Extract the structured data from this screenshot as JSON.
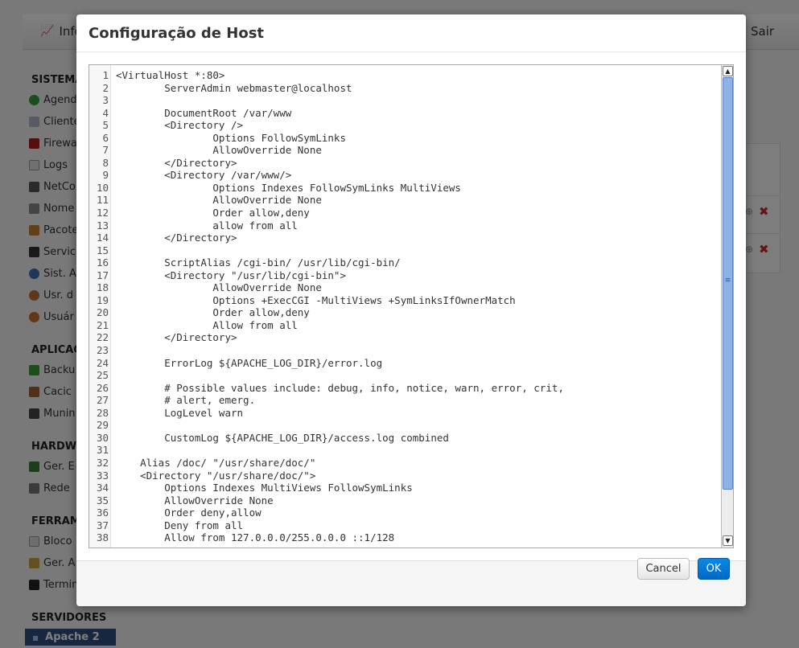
{
  "background": {
    "top_left_label": "Info",
    "top_right_label": "Sair",
    "sections": [
      {
        "title": "SISTEMA",
        "items": [
          "Agend",
          "Cliente",
          "Firewa",
          "Logs",
          "NetCo",
          "Nome",
          "Pacote",
          "Servic",
          "Sist. A",
          "Usr. d",
          "Usuár"
        ]
      },
      {
        "title": "APLICAÇ",
        "items": [
          "Backu",
          "Cacic",
          "Munin"
        ]
      },
      {
        "title": "HARDW",
        "items": [
          "Ger. E",
          "Rede"
        ]
      },
      {
        "title": "FERRAM",
        "items": [
          "Bloco",
          "Ger. A",
          "Termin"
        ]
      },
      {
        "title": "SERVIDORES",
        "items": []
      }
    ],
    "active_server": "Apache 2",
    "delete_glyph": "✖",
    "add_glyph": "⊕"
  },
  "modal": {
    "title": "Configuração de Host",
    "cancel_label": "Cancel",
    "ok_label": "OK"
  },
  "editor": {
    "lines": [
      "<VirtualHost *:80>",
      "        ServerAdmin webmaster@localhost",
      "",
      "        DocumentRoot /var/www",
      "        <Directory />",
      "                Options FollowSymLinks",
      "                AllowOverride None",
      "        </Directory>",
      "        <Directory /var/www/>",
      "                Options Indexes FollowSymLinks MultiViews",
      "                AllowOverride None",
      "                Order allow,deny",
      "                allow from all",
      "        </Directory>",
      "",
      "        ScriptAlias /cgi-bin/ /usr/lib/cgi-bin/",
      "        <Directory \"/usr/lib/cgi-bin\">",
      "                AllowOverride None",
      "                Options +ExecCGI -MultiViews +SymLinksIfOwnerMatch",
      "                Order allow,deny",
      "                Allow from all",
      "        </Directory>",
      "",
      "        ErrorLog ${APACHE_LOG_DIR}/error.log",
      "",
      "        # Possible values include: debug, info, notice, warn, error, crit,",
      "        # alert, emerg.",
      "        LogLevel warn",
      "",
      "        CustomLog ${APACHE_LOG_DIR}/access.log combined",
      "",
      "    Alias /doc/ \"/usr/share/doc/\"",
      "    <Directory \"/usr/share/doc/\">",
      "        Options Indexes MultiViews FollowSymLinks",
      "        AllowOverride None",
      "        Order deny,allow",
      "        Deny from all",
      "        Allow from 127.0.0.0/255.0.0.0 ::1/128"
    ],
    "scroll_position": 0,
    "scroll_visible_fraction": 0.87
  },
  "colors": {
    "ok_button": "#0074d9",
    "scroll_thumb": "#8fb2e6",
    "active_server_bg": "#2f4f7f",
    "delete": "#c62828"
  }
}
